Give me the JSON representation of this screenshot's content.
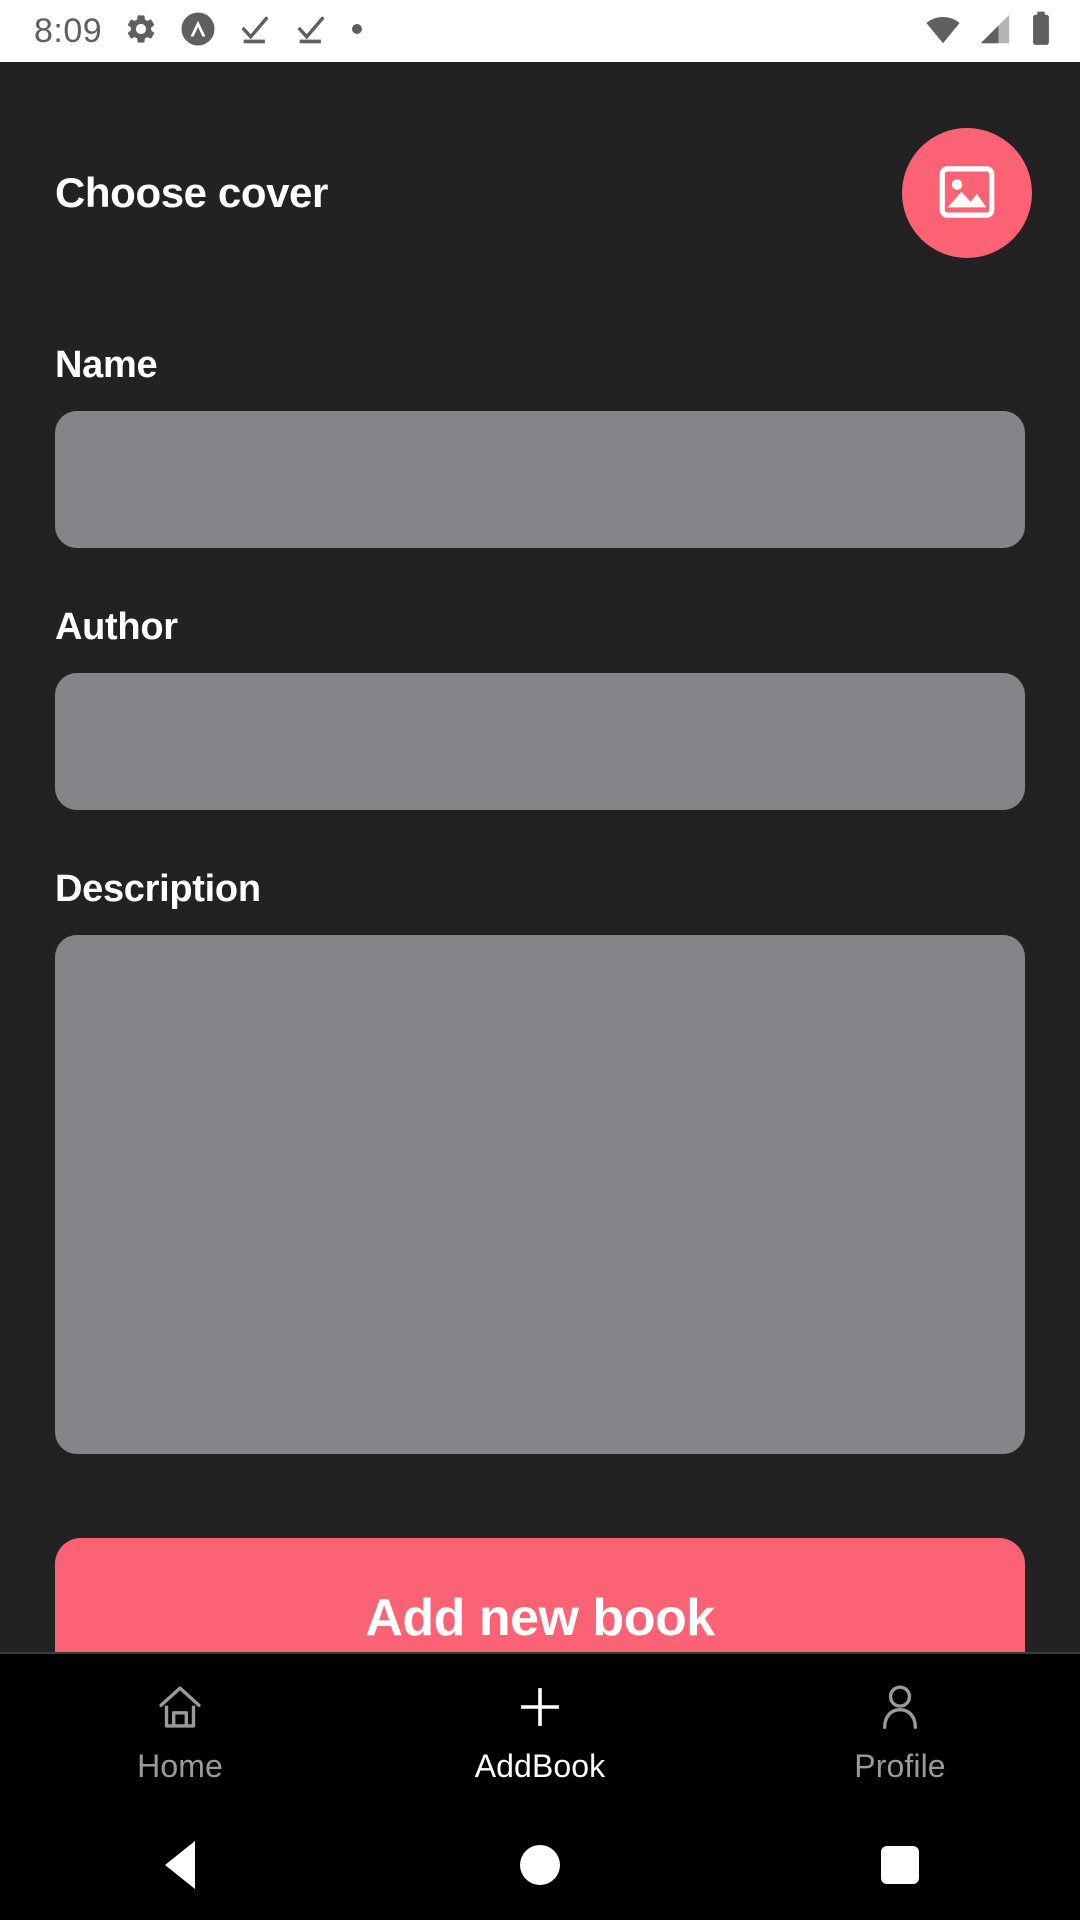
{
  "status_bar": {
    "time": "8:09",
    "icons_left": [
      "gear-icon",
      "expo-caret-icon",
      "task-check-icon",
      "task-check-icon",
      "dot-icon"
    ],
    "icons_right": [
      "wifi-icon",
      "cellular-signal-icon",
      "battery-icon"
    ]
  },
  "screen": {
    "cover": {
      "title": "Choose cover",
      "button_icon": "image-picker-icon"
    },
    "fields": [
      {
        "label": "Name",
        "value": "",
        "placeholder": ""
      },
      {
        "label": "Author",
        "value": "",
        "placeholder": ""
      },
      {
        "label": "Description",
        "value": "",
        "placeholder": ""
      }
    ],
    "submit": {
      "label": "Add new book"
    }
  },
  "tab_bar": {
    "items": [
      {
        "label": "Home",
        "icon": "home-icon",
        "active": false
      },
      {
        "label": "AddBook",
        "icon": "plus-icon",
        "active": true
      },
      {
        "label": "Profile",
        "icon": "person-icon",
        "active": false
      }
    ]
  },
  "nav_bar": {
    "items": [
      {
        "name": "back-button",
        "icon": "triangle-back-icon"
      },
      {
        "name": "home-button",
        "icon": "circle-home-icon"
      },
      {
        "name": "recents-button",
        "icon": "square-recents-icon"
      }
    ]
  },
  "colors": {
    "accent": "#fb6374",
    "background": "#222222",
    "field": "#848589",
    "tab_bar": "#000000",
    "status_bar": "#ffffff",
    "label_text": "#ffffff",
    "tab_inactive_text": "#9a9a9a"
  }
}
